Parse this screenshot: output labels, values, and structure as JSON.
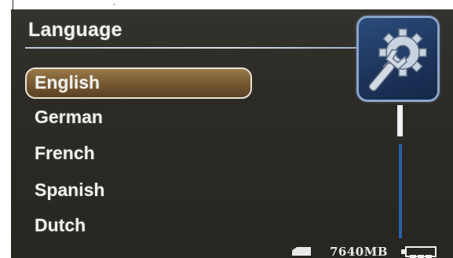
{
  "menu": {
    "title": "Language",
    "items": [
      "English",
      "German",
      "French",
      "Spanish",
      "Dutch"
    ],
    "selected_index": 0
  },
  "status": {
    "storage": "7640MB",
    "battery_level": 0.75
  },
  "icons": {
    "settings": "gear-wrench-icon",
    "storage_card": "sd-card-icon",
    "battery": "battery-icon"
  },
  "colors": {
    "selection_fill": "#7a5c34",
    "scrollbar": "#2a5fa8",
    "icon_box": "#1c3358"
  }
}
